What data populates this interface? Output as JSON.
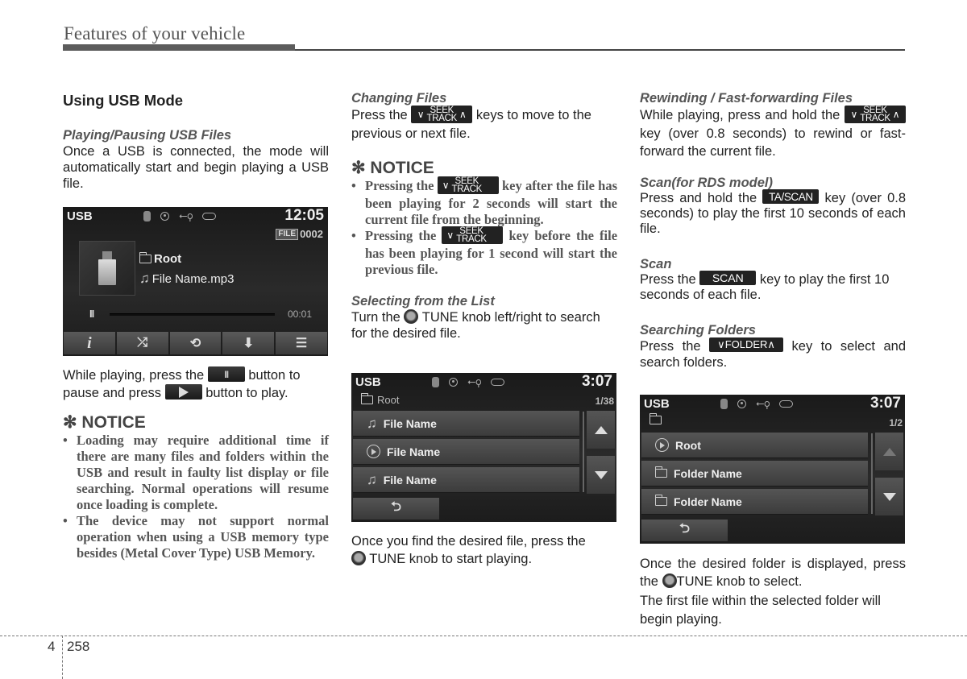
{
  "header": {
    "title": "Features of your vehicle"
  },
  "col1": {
    "main_heading": "Using USB Mode",
    "playing_heading": "Playing/Pausing USB Files",
    "playing_text": "Once a USB is connected, the mode will automatically start and begin playing a USB file.",
    "pause_text_1": "While playing, press the",
    "pause_text_2": "button to pause and press",
    "pause_text_3": "button to play.",
    "pause_key": "II",
    "notice_title": "✻ NOTICE",
    "notice_items": [
      "Loading may require additional time if there are many files and folders within the USB and result in faulty list display or file searching. Normal operations will resume once loading is complete.",
      "The device may not support normal operation when using a USB memory type besides (Metal Cover Type) USB Memory."
    ]
  },
  "screen1": {
    "mode": "USB",
    "clock": "12:05",
    "file_tag": "FILE",
    "file_number": "0002",
    "folder": "Root",
    "file_name": "File Name.mp3",
    "pause_icon": "II",
    "elapsed": "00:01",
    "progress_fraction": 0.0,
    "controls": [
      {
        "name": "info",
        "glyph": "i"
      },
      {
        "name": "shuffle",
        "glyph": "⤮"
      },
      {
        "name": "repeat",
        "glyph": "⟲"
      },
      {
        "name": "save",
        "glyph": "⬇"
      },
      {
        "name": "list",
        "glyph": "☰"
      }
    ]
  },
  "col2": {
    "changing_heading": "Changing Files",
    "changing_text_1": "Press the",
    "changing_text_2": "keys to move to the previous or next file.",
    "notice_title": "✻ NOTICE",
    "notice_1a": "Pressing the",
    "notice_1b": "key after the file has been playing for 2 seconds will start the current file from the beginning.",
    "notice_2a": "Pressing the",
    "notice_2b": "key before the file has been playing for 1 second will start the previous file.",
    "selecting_heading": "Selecting from the List",
    "selecting_text_1": "Turn the",
    "selecting_text_2": "TUNE knob left/right to search for the desired file.",
    "after_text_1": "Once you find the desired file, press the",
    "after_text_2": "TUNE knob to start playing."
  },
  "keys": {
    "seek_top": "SEEK",
    "seek_bottom": "TRACK",
    "down_arrow": "∨",
    "up_arrow": "∧",
    "ta_scan": "TA/SCAN",
    "scan": "SCAN",
    "folder": "FOLDER"
  },
  "screen2": {
    "mode": "USB",
    "clock": "3:07",
    "path": "Root",
    "page": "1/38",
    "items": [
      {
        "type": "music",
        "label": "File Name"
      },
      {
        "type": "playing",
        "label": "File Name"
      },
      {
        "type": "music",
        "label": "File Name"
      }
    ],
    "back_glyph": "⮌"
  },
  "col3": {
    "rewind_heading": "Rewinding / Fast-forwarding Files",
    "rewind_text_1": "While playing, press and hold the",
    "rewind_text_2": "key (over 0.8 seconds) to rewind or fast-forward the current file.",
    "rds_heading": "Scan(for RDS model)",
    "rds_text_1": "Press and hold the",
    "rds_text_2": "key (over 0.8 seconds) to play the first 10 seconds of each file.",
    "scan_heading": "Scan",
    "scan_text_1": "Press the",
    "scan_text_2": "key to play the first 10 seconds of each file.",
    "folders_heading": "Searching Folders",
    "folders_text_1": "Press the",
    "folders_text_2": "key to select and search folders.",
    "after_text_1": "Once the desired folder is displayed, press the",
    "after_text_2": "TUNE knob to select.",
    "after_text_3": "The first file within the selected folder will begin playing."
  },
  "screen3": {
    "mode": "USB",
    "clock": "3:07",
    "path": "",
    "page": "1/2",
    "items": [
      {
        "type": "playing",
        "label": "Root"
      },
      {
        "type": "folder",
        "label": "Folder Name"
      },
      {
        "type": "folder",
        "label": "Folder Name"
      }
    ],
    "back_glyph": "⮌"
  },
  "footer": {
    "chapter": "4",
    "page": "258"
  }
}
